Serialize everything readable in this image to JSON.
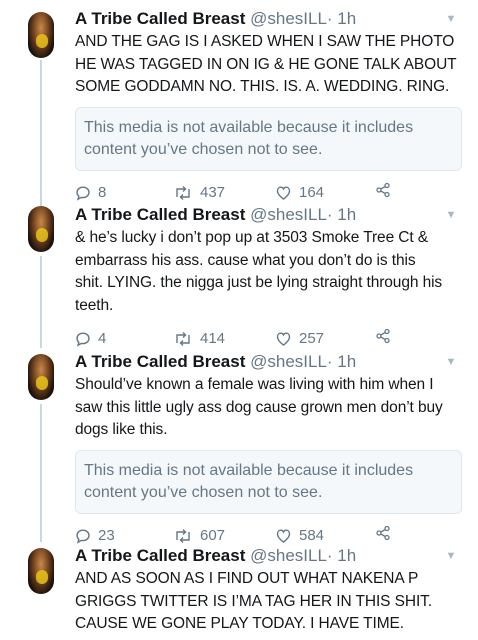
{
  "tweets": [
    {
      "name": "A Tribe Called Breast",
      "handle": "@shesILL",
      "time": "· 1h",
      "lines": [
        "AND THE GAG IS I ASKED WHEN I SAW THE PHOTO",
        "HE WAS TAGGED IN ON IG & HE GONE TALK ABOUT",
        "SOME GODDAMN NO. THIS. IS. A. WEDDING. RING."
      ],
      "media_notice": [
        "This media is not available because it includes",
        "content you’ve chosen not to see."
      ],
      "replies": "8",
      "retweets": "437",
      "likes": "164"
    },
    {
      "name": "A Tribe Called Breast",
      "handle": "@shesILL",
      "time": "· 1h",
      "lines": [
        "& he’s lucky i don’t pop up at 3503 Smoke Tree Ct &",
        "embarrass his ass. cause what you don’t do is this",
        "shit. LYING. the nigga just be lying straight through his",
        "teeth."
      ],
      "replies": "4",
      "retweets": "414",
      "likes": "257"
    },
    {
      "name": "A Tribe Called Breast",
      "handle": "@shesILL",
      "time": "· 1h",
      "lines": [
        "Should’ve known a female was living with him when I",
        "saw this little ugly ass dog cause grown men don’t buy",
        "dogs like this."
      ],
      "media_notice": [
        "This media is not available because it includes",
        "content you’ve chosen not to see."
      ],
      "replies": "23",
      "retweets": "607",
      "likes": "584"
    },
    {
      "name": "A Tribe Called Breast",
      "handle": "@shesILL",
      "time": "· 1h",
      "lines": [
        "AND AS SOON AS I FIND OUT WHAT NAKENA P",
        "GRIGGS TWITTER IS I’MA TAG HER IN THIS SHIT.",
        "CAUSE WE GONE PLAY TODAY. I HAVE TIME."
      ]
    }
  ],
  "icons": {
    "reply": "reply-icon",
    "retweet": "retweet-icon",
    "like": "heart-icon",
    "share": "share-icon",
    "more": "chevron-down-icon"
  },
  "colors": {
    "text": "#14171a",
    "muted": "#657786",
    "thread_line": "#ccd6dd",
    "media_bg": "#f5f8fa"
  }
}
